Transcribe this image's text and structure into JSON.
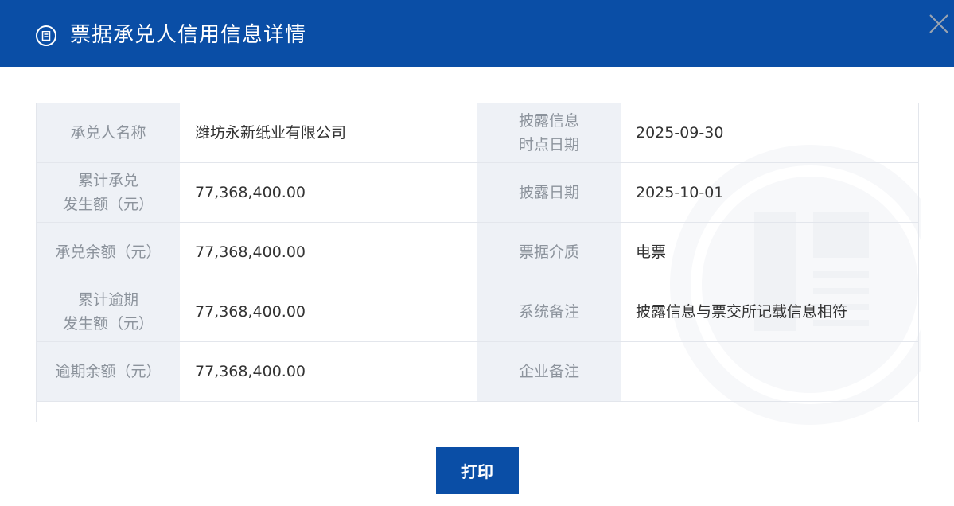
{
  "header": {
    "title": "票据承兑人信用信息详情",
    "icon": "document-list-icon",
    "close_icon": "close-icon"
  },
  "table": {
    "rows": [
      {
        "left_label": "承兑人名称",
        "left_value": "潍坊永新纸业有限公司",
        "right_label_line1": "披露信息",
        "right_label_line2": "时点日期",
        "right_value": "2025-09-30"
      },
      {
        "left_label_line1": "累计承兑",
        "left_label_line2": "发生额（元）",
        "left_value": "77,368,400.00",
        "right_label": "披露日期",
        "right_value": "2025-10-01"
      },
      {
        "left_label": "承兑余额（元）",
        "left_value": "77,368,400.00",
        "right_label": "票据介质",
        "right_value": "电票"
      },
      {
        "left_label_line1": "累计逾期",
        "left_label_line2": "发生额（元）",
        "left_value": "77,368,400.00",
        "right_label": "系统备注",
        "right_value": "披露信息与票交所记载信息相符"
      },
      {
        "left_label": "逾期余额（元）",
        "left_value": "77,368,400.00",
        "right_label": "企业备注",
        "right_value": ""
      }
    ]
  },
  "footer": {
    "print_label": "打印"
  },
  "colors": {
    "primary": "#0a4ea6",
    "label_bg": "#eef1f6",
    "label_text": "#8c939c",
    "value_text": "#333333"
  }
}
